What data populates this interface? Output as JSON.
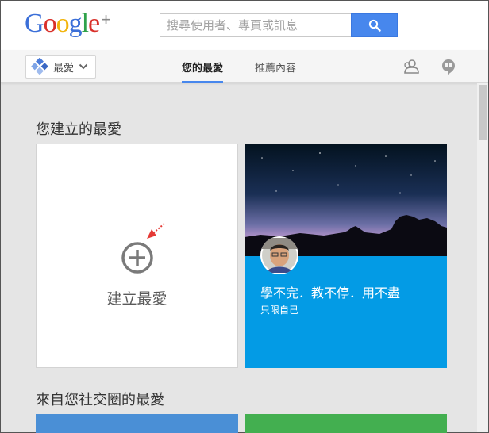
{
  "header": {
    "search": {
      "placeholder": "搜尋使用者、專頁或訊息"
    }
  },
  "nav": {
    "home_label": "最愛",
    "tabs": [
      {
        "label": "您的最愛",
        "active": true
      },
      {
        "label": "推薦內容",
        "active": false
      }
    ]
  },
  "sections": {
    "created_title": "您建立的最愛",
    "circles_title": "來自您社交圈的最愛"
  },
  "create_card": {
    "label": "建立最愛"
  },
  "collection_card": {
    "title": "學不完．教不停．用不盡",
    "visibility": "只限自己"
  },
  "colors": {
    "accent": "#4787ed",
    "collection": "#039be5",
    "bottom_left": "#4a8fd6",
    "bottom_right": "#43af50"
  }
}
